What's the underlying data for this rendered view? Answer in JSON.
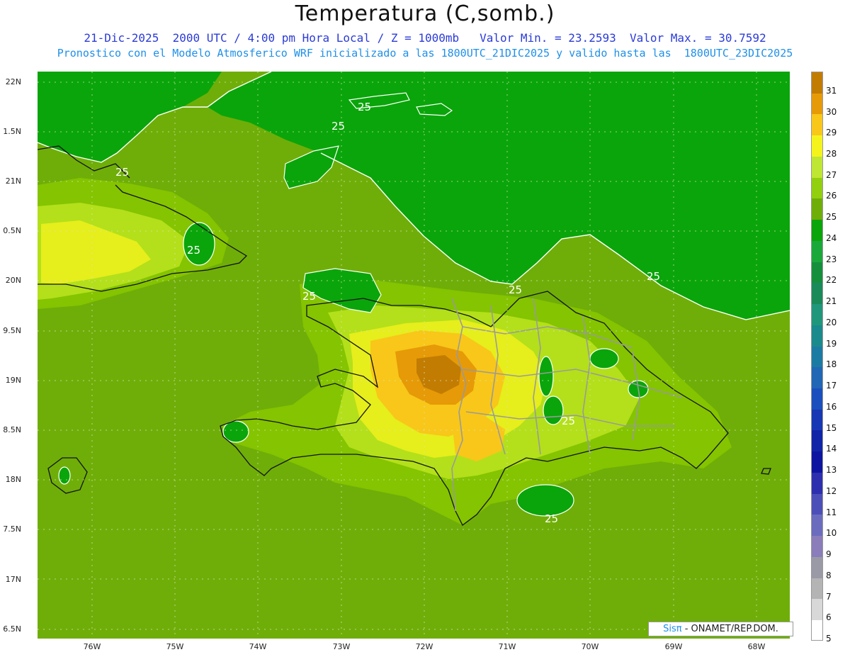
{
  "header": {
    "title": "Temperatura (C,somb.)",
    "subtitle_line1": "21-Dic-2025  2000 UTC / 4:00 pm Hora Local / Z = 1000mb   Valor Min. = 23.2593  Valor Max. = 30.7592",
    "subtitle_line2": "Pronostico con el Modelo Atmosferico WRF inicializado a las 1800UTC_21DIC2025 y valido hasta las  1800UTC_23DIC2025"
  },
  "map": {
    "lat_labels": [
      "22N",
      "1.5N",
      "21N",
      "0.5N",
      "20N",
      "9.5N",
      "19N",
      "8.5N",
      "18N",
      "7.5N",
      "17N",
      "6.5N"
    ],
    "lon_labels": [
      "76W",
      "75W",
      "74W",
      "73W",
      "72W",
      "71W",
      "70W",
      "69W",
      "68W"
    ],
    "contour_value": "25",
    "grid_lines": "dotted",
    "colors": {
      "ocean_base": "#6fae08",
      "cool_sea": "#0aa50a",
      "cooler_patch": "#1f8e1f",
      "warm_26": "#84c400",
      "warm_27": "#b3e01a",
      "warm_28": "#e6ee1c",
      "warm_29": "#f8c719",
      "warm_30": "#e69a07",
      "warm_31": "#c27c02",
      "coast_line": "#111111",
      "border_line": "#9a9a9a",
      "contour_line": "#ffffff"
    }
  },
  "colorbar": {
    "labels": [
      "31",
      "30",
      "29",
      "28",
      "27",
      "26",
      "25",
      "24",
      "23",
      "22",
      "21",
      "20",
      "19",
      "18",
      "17",
      "16",
      "15",
      "14",
      "13",
      "12",
      "11",
      "10",
      "9",
      "8",
      "7",
      "6",
      "5"
    ],
    "colors": [
      "#c27c02",
      "#e69a07",
      "#f8c719",
      "#f4f41c",
      "#bfe632",
      "#91cf0f",
      "#6fae08",
      "#0aa50a",
      "#1aa83b",
      "#168f3d",
      "#1a8a5a",
      "#20977a",
      "#1a8a8c",
      "#1c7ba3",
      "#2266b6",
      "#1a4fbd",
      "#1837b4",
      "#1024a8",
      "#0d15a0",
      "#2e2fae",
      "#4d4fb8",
      "#6b6cbe",
      "#8b7cba",
      "#9a9aa6",
      "#b4b4b4",
      "#d8d8d8",
      "#ffffff"
    ]
  },
  "credit": {
    "brand": "Sisπ",
    "text": " - ONAMET/REP.DOM."
  }
}
